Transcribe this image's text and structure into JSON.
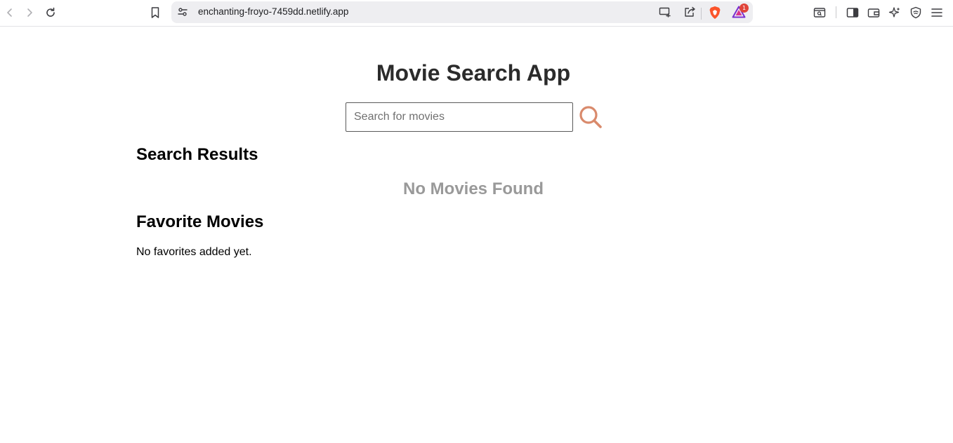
{
  "browser": {
    "url": "enchanting-froyo-7459dd.netlify.app",
    "notification_count": "1"
  },
  "app": {
    "title": "Movie Search App",
    "search": {
      "placeholder": "Search for movies",
      "value": ""
    },
    "results": {
      "heading": "Search Results",
      "empty_text": "No Movies Found"
    },
    "favorites": {
      "heading": "Favorite Movies",
      "empty_text": "No favorites added yet."
    }
  },
  "colors": {
    "search_icon": "#d98a6c",
    "empty_text": "#999999",
    "brave_lion": "#fb542b"
  }
}
